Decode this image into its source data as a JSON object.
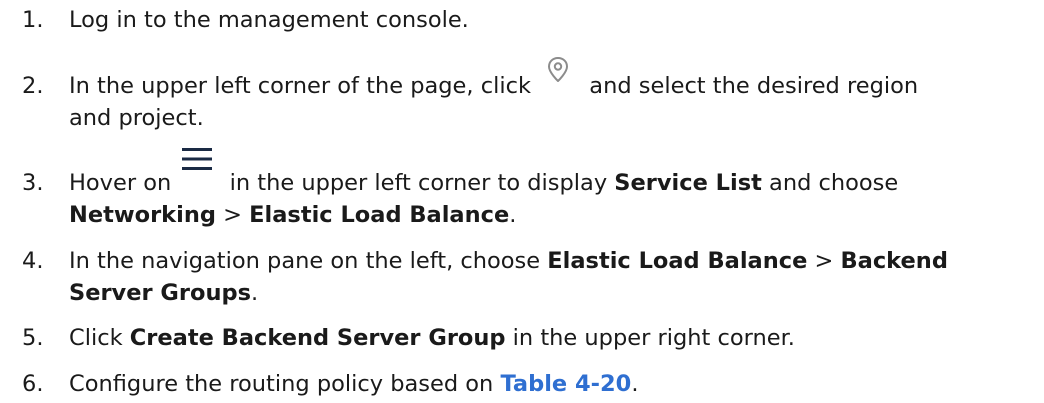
{
  "steps": [
    {
      "number": "1.",
      "text": "Log in to the management console."
    },
    {
      "number": "2.",
      "text_before_icon": "In the upper left corner of the page, click",
      "icon": "location-pin-icon",
      "text_after_icon": "and select the desired region",
      "text_line2": "and project."
    },
    {
      "number": "3.",
      "text_before_icon": "Hover on",
      "icon": "hamburger-menu-icon",
      "text_after_icon": "in the upper left corner to display",
      "bold_service_list": "Service List",
      "text_and_choose": "and choose",
      "bold_networking": "Networking",
      "separator": ">",
      "bold_elb": "Elastic Load Balance",
      "end_period": "."
    },
    {
      "number": "4.",
      "text_before": "In the navigation pane on the left, choose",
      "bold_elb": "Elastic Load Balance",
      "separator": ">",
      "bold_backend_1": "Backend",
      "bold_backend_2": "Server Groups",
      "end_period": "."
    },
    {
      "number": "5.",
      "text_before": "Click",
      "bold_create": "Create Backend Server Group",
      "text_after": "in the upper right corner."
    },
    {
      "number": "6.",
      "text_before": "Configure the routing policy based on",
      "link_table": "Table 4-20",
      "end_period": "."
    }
  ],
  "colors": {
    "text": "#1a1a1a",
    "link": "#2f6fd1",
    "icon_pin": "#8c8c8c",
    "icon_menu": "#1a2a44"
  }
}
